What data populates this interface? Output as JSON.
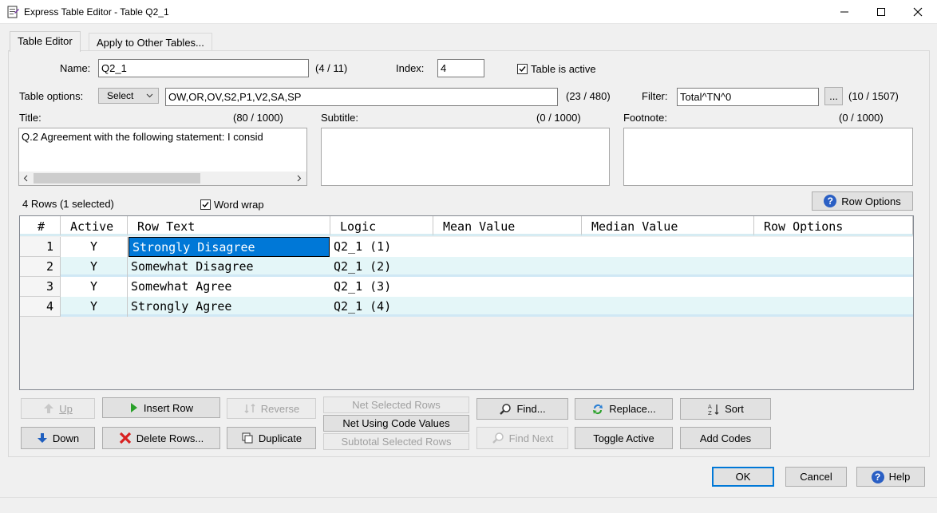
{
  "window": {
    "title": "Express Table Editor - Table Q2_1",
    "minimize": "—",
    "maximize": "☐",
    "close": "✕"
  },
  "tabs": [
    {
      "label": "Table Editor",
      "active": true
    },
    {
      "label": "Apply to Other Tables...",
      "active": false
    }
  ],
  "name": {
    "label": "Name:",
    "value": "Q2_1",
    "count": "(4 / 11)"
  },
  "index": {
    "label": "Index:",
    "value": "4"
  },
  "table_active": {
    "label": "Table is active",
    "checked": true
  },
  "table_options": {
    "label": "Table options:",
    "select_label": "Select",
    "value": "OW,OR,OV,S2,P1,V2,SA,SP",
    "count": "(23 / 480)"
  },
  "filter": {
    "label": "Filter:",
    "value": "Total^TN^0",
    "browse": "...",
    "count": "(10 / 1507)"
  },
  "title": {
    "label": "Title:",
    "count": "(80 / 1000)",
    "value": "Q.2 Agreement with the following statement: I consid"
  },
  "subtitle": {
    "label": "Subtitle:",
    "count": "(0 / 1000)",
    "value": ""
  },
  "footnote": {
    "label": "Footnote:",
    "count": "(0 / 1000)",
    "value": ""
  },
  "rows_status": "4 Rows  (1 selected)",
  "word_wrap": {
    "label": "Word wrap",
    "checked": true
  },
  "row_options_button": "Row Options",
  "grid": {
    "columns": [
      "#",
      "Active",
      "Row Text",
      "Logic",
      "Mean Value",
      "Median Value",
      "Row Options"
    ],
    "rows": [
      {
        "num": "1",
        "active": "Y",
        "text": "Strongly Disagree",
        "logic": "Q2_1 (1)",
        "mean": "",
        "median": "",
        "options": "",
        "selected": true
      },
      {
        "num": "2",
        "active": "Y",
        "text": "Somewhat Disagree",
        "logic": "Q2_1 (2)",
        "mean": "",
        "median": "",
        "options": ""
      },
      {
        "num": "3",
        "active": "Y",
        "text": "Somewhat Agree",
        "logic": "Q2_1 (3)",
        "mean": "",
        "median": "",
        "options": ""
      },
      {
        "num": "4",
        "active": "Y",
        "text": "Strongly Agree",
        "logic": "Q2_1 (4)",
        "mean": "",
        "median": "",
        "options": ""
      }
    ]
  },
  "buttons": {
    "up": "Up",
    "down": "Down",
    "insert_row": "Insert Row",
    "delete_rows": "Delete Rows...",
    "reverse": "Reverse",
    "duplicate": "Duplicate",
    "net_selected": "Net Selected Rows",
    "net_codes": "Net Using Code Values",
    "subtotal": "Subtotal Selected Rows",
    "find": "Find...",
    "find_next": "Find Next",
    "replace": "Replace...",
    "toggle_active": "Toggle Active",
    "sort": "Sort",
    "add_codes": "Add Codes",
    "ok": "OK",
    "cancel": "Cancel",
    "help": "Help"
  },
  "colors": {
    "selection": "#0078d7",
    "alt_row": "#e4f6f8",
    "accent": "#0078d7"
  }
}
